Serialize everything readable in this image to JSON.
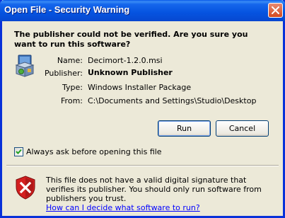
{
  "window": {
    "title": "Open File - Security Warning"
  },
  "question": "The publisher could not be verified.  Are you sure you want to run this software?",
  "fields": {
    "name_label": "Name:",
    "name_value": "Decimort-1.2.0.msi",
    "publisher_label": "Publisher:",
    "publisher_value": "Unknown Publisher",
    "type_label": "Type:",
    "type_value": "Windows Installer Package",
    "from_label": "From:",
    "from_value": "C:\\Documents and Settings\\Studio\\Desktop"
  },
  "buttons": {
    "run": "Run",
    "cancel": "Cancel"
  },
  "checkbox": {
    "label": "Always ask before opening this file",
    "checked": true
  },
  "warning": {
    "text": "This file does not have a valid digital signature that verifies its publisher.  You should only run software from publishers you trust.",
    "link": "How can I decide what software to run?"
  },
  "icons": {
    "close": "close-icon",
    "package": "installer-package-icon",
    "shield": "security-shield-icon",
    "check": "checkmark-icon"
  },
  "colors": {
    "titlebar": "#0553e0",
    "close_button": "#d44a1f",
    "shield": "#d42020",
    "link": "#0000ff"
  }
}
